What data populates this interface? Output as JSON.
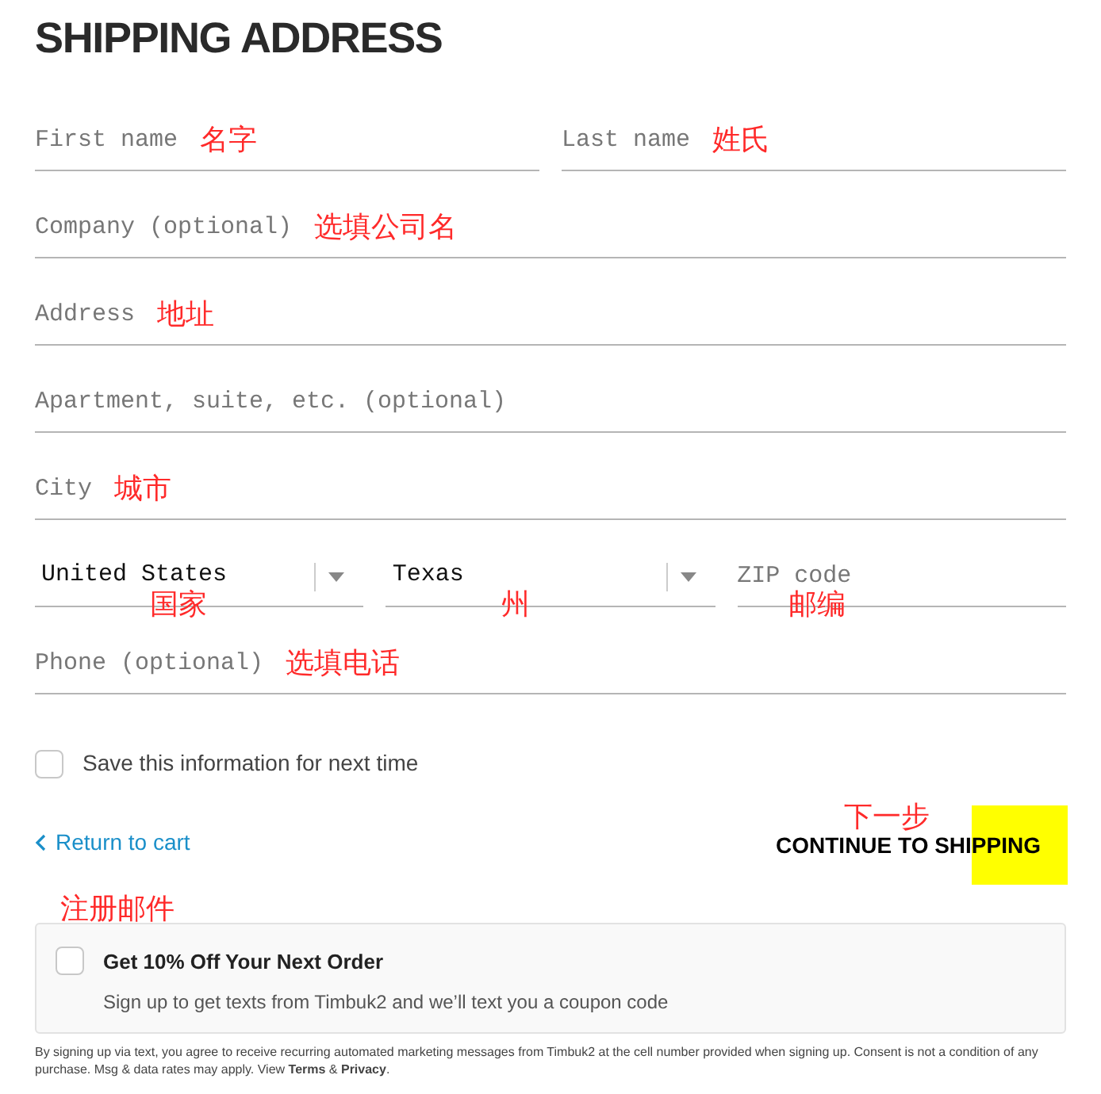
{
  "title": "SHIPPING ADDRESS",
  "rows": [
    {
      "fields": [
        {
          "kind": "text",
          "placeholder": "First name",
          "annotation": "名字"
        },
        {
          "kind": "text",
          "placeholder": "Last name",
          "annotation": "姓氏"
        }
      ]
    },
    {
      "fields": [
        {
          "kind": "text",
          "placeholder": "Company (optional)",
          "annotation": "选填公司名"
        }
      ]
    },
    {
      "fields": [
        {
          "kind": "text",
          "placeholder": "Address",
          "annotation": "地址"
        }
      ]
    },
    {
      "fields": [
        {
          "kind": "text",
          "placeholder": "Apartment, suite, etc. (optional)"
        }
      ]
    },
    {
      "fields": [
        {
          "kind": "text",
          "placeholder": "City",
          "annotation": "城市"
        }
      ]
    },
    {
      "fields": [
        {
          "kind": "select",
          "value": "United States",
          "annotation": "国家"
        },
        {
          "kind": "select",
          "value": "Texas",
          "annotation": "州"
        },
        {
          "kind": "text",
          "placeholder": "ZIP code",
          "annotation": "邮编"
        }
      ]
    },
    {
      "fields": [
        {
          "kind": "text",
          "placeholder": "Phone (optional)",
          "annotation": "选填电话"
        }
      ]
    }
  ],
  "save_info": {
    "label": "Save this information for next time",
    "checked": false
  },
  "return_link": "Return to cart",
  "continue": {
    "label": "CONTINUE TO SHIPPING",
    "annotation": "下一步"
  },
  "promo": {
    "annotation": "注册邮件",
    "title": "Get 10% Off Your Next Order",
    "subtitle": "Sign up to get texts from Timbuk2 and we’ll text you a coupon code",
    "checked": false
  },
  "disclaimer": "By signing up via text, you agree to receive recurring automated marketing messages from Timbuk2 at the cell number provided when signing up. Consent is not a condition of any purchase. Msg & data rates may apply. View **Terms** & **Privacy**."
}
